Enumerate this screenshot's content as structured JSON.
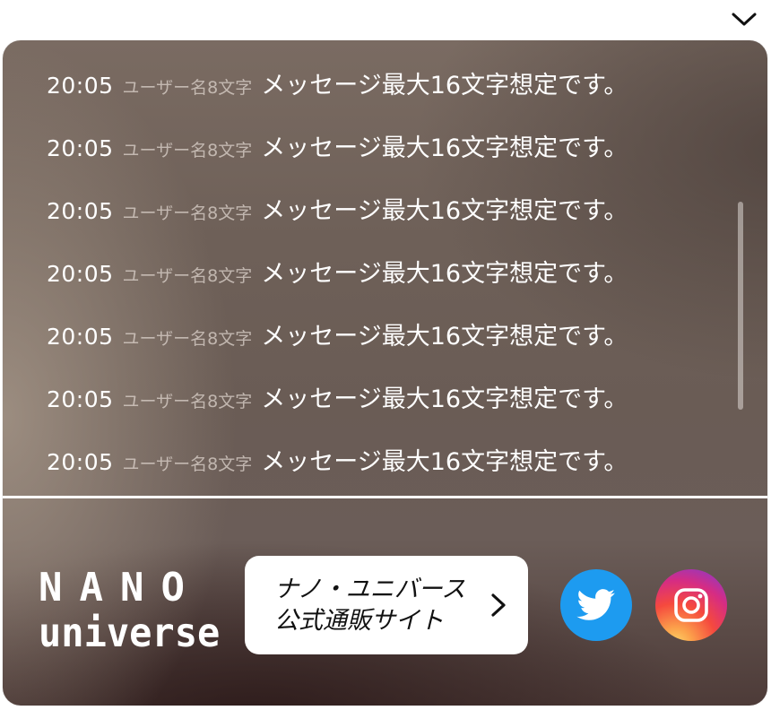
{
  "header": {
    "collapse_icon": "chevron-down-icon"
  },
  "chat": {
    "messages": [
      {
        "time": "20:05",
        "user": "ユーザー名8文字",
        "text": "メッセージ最大16文字想定です。"
      },
      {
        "time": "20:05",
        "user": "ユーザー名8文字",
        "text": "メッセージ最大16文字想定です。"
      },
      {
        "time": "20:05",
        "user": "ユーザー名8文字",
        "text": "メッセージ最大16文字想定です。"
      },
      {
        "time": "20:05",
        "user": "ユーザー名8文字",
        "text": "メッセージ最大16文字想定です。"
      },
      {
        "time": "20:05",
        "user": "ユーザー名8文字",
        "text": "メッセージ最大16文字想定です。"
      },
      {
        "time": "20:05",
        "user": "ユーザー名8文字",
        "text": "メッセージ最大16文字想定です。"
      },
      {
        "time": "20:05",
        "user": "ユーザー名8文字",
        "text": "メッセージ最大16文字想定です。"
      }
    ]
  },
  "footer": {
    "logo": {
      "line1": "NANO",
      "line2": "universe"
    },
    "shop_button": {
      "line1": "ナノ・ユニバース",
      "line2": "公式通販サイト",
      "icon": "chevron-right-icon"
    },
    "social": [
      {
        "name": "twitter",
        "icon": "twitter-bird-icon",
        "color": "#1d9bf0"
      },
      {
        "name": "instagram",
        "icon": "instagram-camera-icon",
        "color": "#d62c83"
      }
    ]
  }
}
